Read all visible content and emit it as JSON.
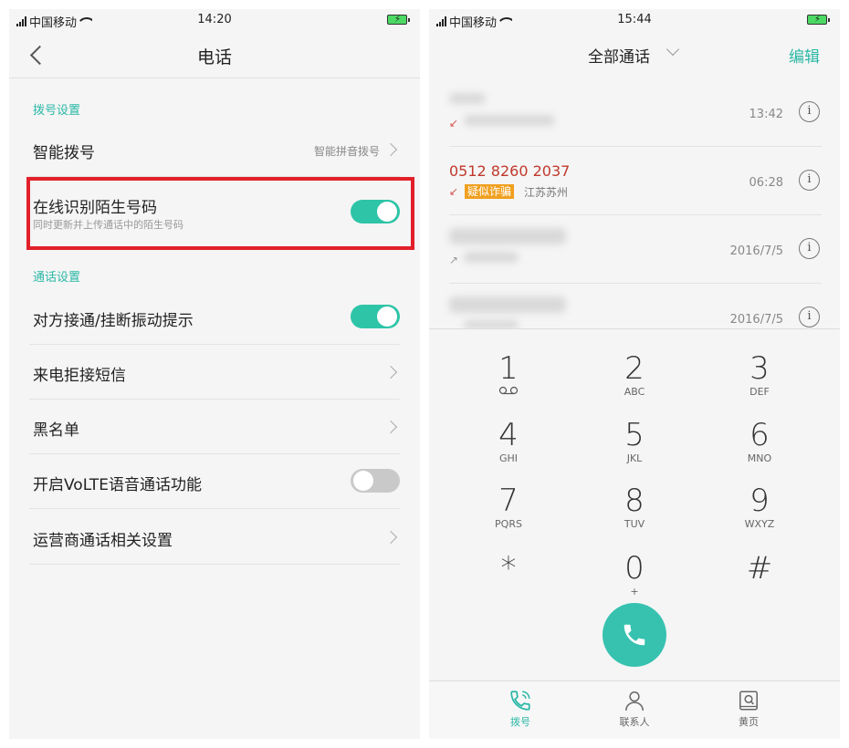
{
  "left": {
    "status": {
      "carrier": "中国移动",
      "time": "14:20"
    },
    "header": {
      "title": "电话"
    },
    "sections": [
      {
        "title": "拨号设置"
      },
      {
        "title": "通话设置"
      }
    ],
    "rows": [
      {
        "label": "智能拨号",
        "value": "智能拼音拨号"
      },
      {
        "label": "在线识别陌生号码",
        "sub": "同时更新并上传通话中的陌生号码",
        "toggle": "on"
      },
      {
        "label": "对方接通/挂断振动提示",
        "toggle": "on"
      },
      {
        "label": "来电拒接短信"
      },
      {
        "label": "黑名单"
      },
      {
        "label": "开启VoLTE语音通话功能",
        "toggle": "off"
      },
      {
        "label": "运营商通话相关设置"
      }
    ]
  },
  "right": {
    "status": {
      "carrier": "中国移动",
      "time": "15:44"
    },
    "header": {
      "title": "全部通话",
      "edit": "编辑"
    },
    "calls": [
      {
        "number": "",
        "time": "13:42",
        "direction": "missed"
      },
      {
        "number": "0512 8260 2037",
        "tag": "疑似诈骗",
        "location": "江苏苏州",
        "time": "06:28",
        "direction": "missed"
      },
      {
        "number": "",
        "time": "2016/7/5",
        "direction": "outgoing"
      },
      {
        "number": "",
        "time": "2016/7/5",
        "direction": "incoming"
      }
    ],
    "keypad": [
      {
        "digit": "1",
        "letters": ""
      },
      {
        "digit": "2",
        "letters": "ABC"
      },
      {
        "digit": "3",
        "letters": "DEF"
      },
      {
        "digit": "4",
        "letters": "GHI"
      },
      {
        "digit": "5",
        "letters": "JKL"
      },
      {
        "digit": "6",
        "letters": "MNO"
      },
      {
        "digit": "7",
        "letters": "PQRS"
      },
      {
        "digit": "8",
        "letters": "TUV"
      },
      {
        "digit": "9",
        "letters": "WXYZ"
      },
      {
        "digit": "*",
        "letters": ""
      },
      {
        "digit": "0",
        "letters": "+"
      },
      {
        "digit": "#",
        "letters": ""
      }
    ],
    "tabs": [
      {
        "label": "拨号",
        "icon": "dial-icon",
        "active": true
      },
      {
        "label": "联系人",
        "icon": "contacts-icon",
        "active": false
      },
      {
        "label": "黄页",
        "icon": "yellow-pages-icon",
        "active": false
      }
    ],
    "colors": {
      "accent": "#2bb8a6",
      "alert": "#e2202a",
      "fraud_tag": "#f0a020"
    }
  }
}
